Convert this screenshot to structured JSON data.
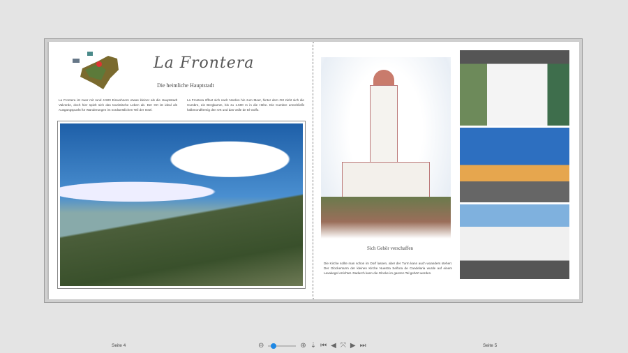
{
  "left_page": {
    "title": "La Frontera",
    "subtitle": "Die heimliche Hauptstadt",
    "col1": "La Frontera ist zwar mit rund 4.500 Einwohnern etwas kleiner als die Hauptstadt Valverde, doch hier spielt sich das touristische Leben ab. Der Ort ist ideal als Ausgangspunkt für Wanderungen im nordwestlichen Teil der Insel.",
    "col2": "La Frontera öffnet sich nach Norden hin zum Meer, hinter dem Ort zieht sich die Cumbre, ein Bergkamm, bis zu 1.500 m in die Höhe. Die Cumbre umschließt halbmondförmig den Ort und das Valle de El Golfo."
  },
  "right_page": {
    "caption": "Sich Gehör verschaffen",
    "text": "Die Kirche sollte man schon im Dorf lassen, aber der Turm kann auch woanders stehen: Der Glockenturm der kleinen Kirche Nuestra Señora de Candelaria wurde auf einem Lavakegel errichtet. Dadurch kann die Glocke im ganzen Tal gehört werden."
  },
  "footer": {
    "left_label": "Seite 4",
    "right_label": "Seite 5"
  },
  "toolbar": {
    "zoom_level": 0.1,
    "icons": [
      "zoom-out",
      "zoom-slider",
      "zoom-in",
      "insert-page",
      "first-page",
      "previous-page",
      "fit-page",
      "next-page",
      "last-page"
    ]
  }
}
